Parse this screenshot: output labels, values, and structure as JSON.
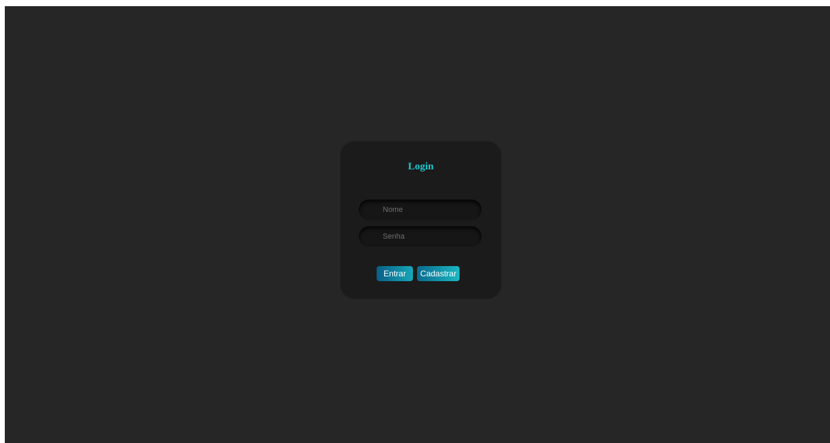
{
  "login_form": {
    "title": "Login",
    "username_placeholder": "Nome",
    "password_placeholder": "Senha",
    "submit_label": "Entrar",
    "register_label": "Cadastrar"
  },
  "colors": {
    "page_background": "#262626",
    "card_background": "#1b1b1b",
    "accent": "#19c9cf",
    "button_gradient_start": "#0b5f87",
    "button_gradient_end": "#16a7b8"
  }
}
